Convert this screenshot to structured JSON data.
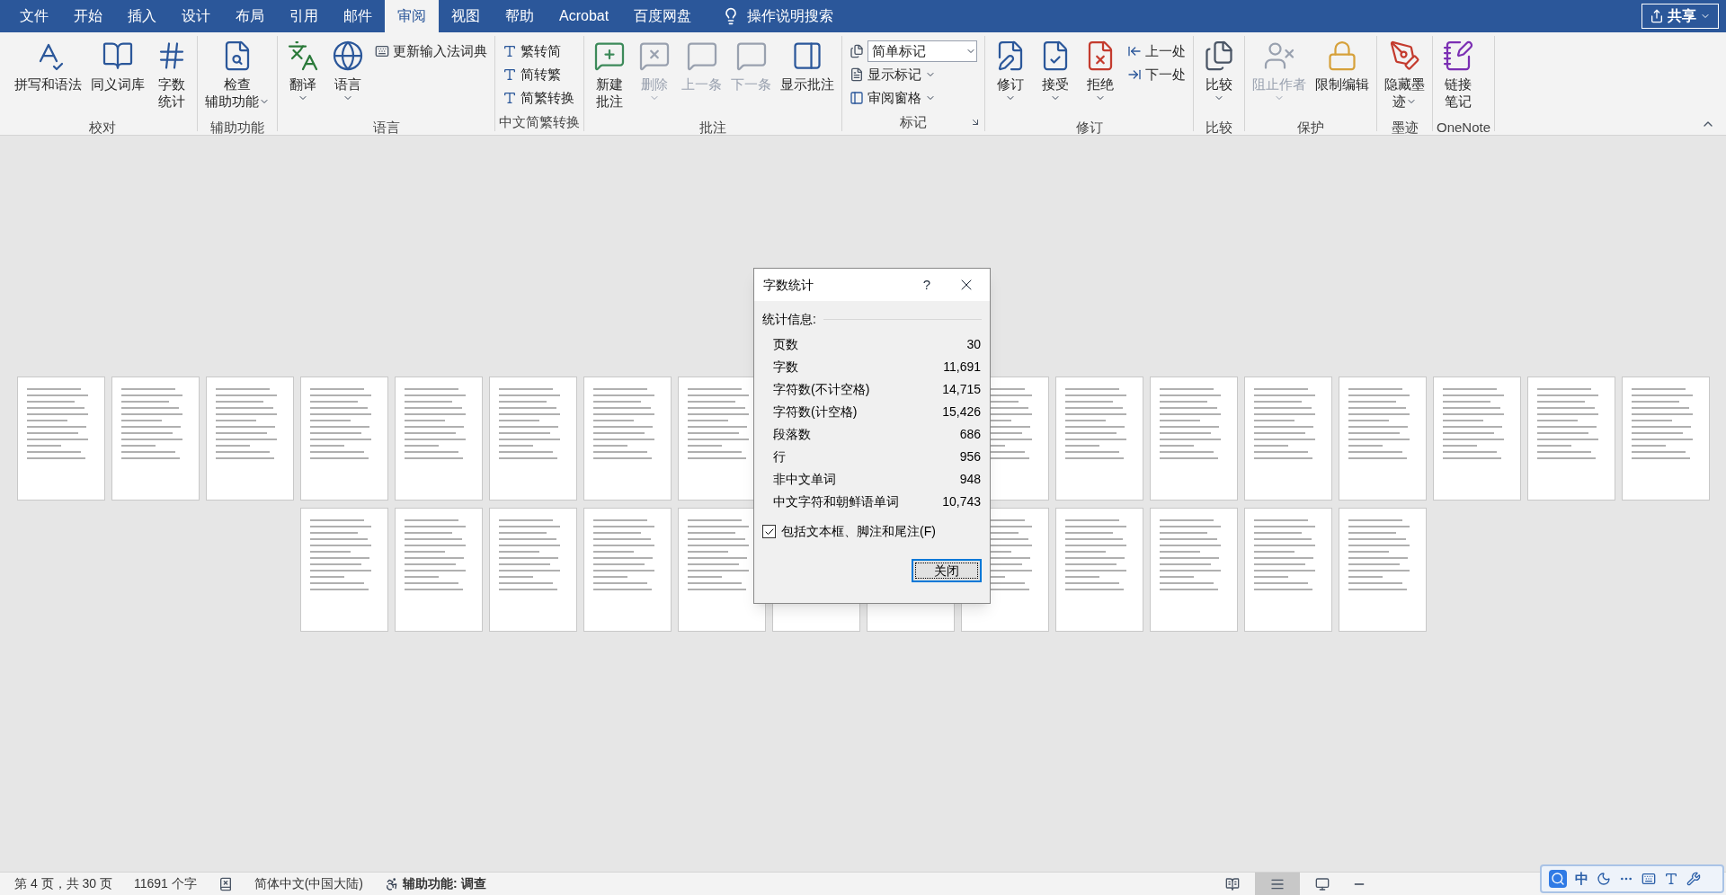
{
  "menu_tabs": [
    {
      "label": "文件",
      "selected": false
    },
    {
      "label": "开始",
      "selected": false
    },
    {
      "label": "插入",
      "selected": false
    },
    {
      "label": "设计",
      "selected": false
    },
    {
      "label": "布局",
      "selected": false
    },
    {
      "label": "引用",
      "selected": false
    },
    {
      "label": "邮件",
      "selected": false
    },
    {
      "label": "审阅",
      "selected": true
    },
    {
      "label": "视图",
      "selected": false
    },
    {
      "label": "帮助",
      "selected": false
    },
    {
      "label": "Acrobat",
      "selected": false
    },
    {
      "label": "百度网盘",
      "selected": false
    }
  ],
  "search": {
    "label": "操作说明搜索"
  },
  "share_button": {
    "label": "共享"
  },
  "ribbon_groups": [
    {
      "label": "校对",
      "launcher": false,
      "items": [
        {
          "kind": "large",
          "lines": [
            "拼写和语法"
          ],
          "disabled": false,
          "dropdown": false
        },
        {
          "kind": "large",
          "lines": [
            "同义词库"
          ],
          "disabled": false,
          "dropdown": false
        },
        {
          "kind": "large",
          "lines": [
            "字数",
            "统计"
          ],
          "disabled": false,
          "dropdown": false
        }
      ]
    },
    {
      "label": "辅助功能",
      "launcher": false,
      "items": [
        {
          "kind": "large",
          "lines": [
            "检查",
            "辅助功能"
          ],
          "disabled": false,
          "dropdown": true
        }
      ]
    },
    {
      "label": "语言",
      "launcher": false,
      "items": [
        {
          "kind": "large",
          "lines": [
            "翻译"
          ],
          "disabled": false,
          "dropdown": true
        },
        {
          "kind": "large",
          "lines": [
            "语言"
          ],
          "disabled": false,
          "dropdown": true
        },
        {
          "kind": "small",
          "lines": [
            "更新输入法词典"
          ],
          "disabled": false,
          "dropdown": false
        }
      ]
    },
    {
      "label": "中文简繁转换",
      "launcher": false,
      "items": [
        {
          "kind": "small",
          "lines": [
            "繁转简"
          ],
          "disabled": false,
          "dropdown": false
        },
        {
          "kind": "small",
          "lines": [
            "简转繁"
          ],
          "disabled": false,
          "dropdown": false
        },
        {
          "kind": "small",
          "lines": [
            "简繁转换"
          ],
          "disabled": false,
          "dropdown": false
        }
      ]
    },
    {
      "label": "批注",
      "launcher": false,
      "items": [
        {
          "kind": "large",
          "lines": [
            "新建",
            "批注"
          ],
          "disabled": false,
          "dropdown": false
        },
        {
          "kind": "large",
          "lines": [
            "删除"
          ],
          "disabled": true,
          "dropdown": true
        },
        {
          "kind": "large",
          "lines": [
            "上一条"
          ],
          "disabled": true,
          "dropdown": false
        },
        {
          "kind": "large",
          "lines": [
            "下一条"
          ],
          "disabled": true,
          "dropdown": false
        },
        {
          "kind": "large",
          "lines": [
            "显示批注"
          ],
          "disabled": false,
          "dropdown": false
        }
      ]
    },
    {
      "label": "标记",
      "launcher": true,
      "items": [
        {
          "kind": "combo",
          "lines": [
            "简单标记"
          ],
          "disabled": false,
          "dropdown": true
        },
        {
          "kind": "small",
          "lines": [
            "显示标记"
          ],
          "disabled": false,
          "dropdown": true
        },
        {
          "kind": "small",
          "lines": [
            "审阅窗格"
          ],
          "disabled": false,
          "dropdown": true
        }
      ]
    },
    {
      "label": "修订",
      "launcher": false,
      "items": [
        {
          "kind": "large",
          "lines": [
            "修订"
          ],
          "disabled": false,
          "dropdown": true
        },
        {
          "kind": "large",
          "lines": [
            "接受"
          ],
          "disabled": false,
          "dropdown": true
        },
        {
          "kind": "large",
          "lines": [
            "拒绝"
          ],
          "disabled": false,
          "dropdown": true
        },
        {
          "kind": "small",
          "lines": [
            "上一处"
          ],
          "disabled": false,
          "dropdown": false
        },
        {
          "kind": "small",
          "lines": [
            "下一处"
          ],
          "disabled": false,
          "dropdown": false
        }
      ]
    },
    {
      "label": "比较",
      "launcher": false,
      "items": [
        {
          "kind": "large",
          "lines": [
            "比较"
          ],
          "disabled": false,
          "dropdown": true
        }
      ]
    },
    {
      "label": "保护",
      "launcher": false,
      "items": [
        {
          "kind": "large",
          "lines": [
            "阻止作者"
          ],
          "disabled": true,
          "dropdown": true
        },
        {
          "kind": "large",
          "lines": [
            "限制编辑"
          ],
          "disabled": false,
          "dropdown": false
        }
      ]
    },
    {
      "label": "墨迹",
      "launcher": false,
      "items": [
        {
          "kind": "large",
          "lines": [
            "隐藏墨",
            "迹"
          ],
          "disabled": false,
          "dropdown": true
        }
      ]
    },
    {
      "label": "OneNote",
      "launcher": false,
      "items": [
        {
          "kind": "large",
          "lines": [
            "链接",
            "笔记"
          ],
          "disabled": false,
          "dropdown": false
        }
      ]
    }
  ],
  "dialog": {
    "title": "字数统计",
    "help": "?",
    "section": "统计信息:",
    "stats": [
      {
        "label": "页数",
        "value": "30"
      },
      {
        "label": "字数",
        "value": "11,691"
      },
      {
        "label": "字符数(不计空格)",
        "value": "14,715"
      },
      {
        "label": "字符数(计空格)",
        "value": "15,426"
      },
      {
        "label": "段落数",
        "value": "686"
      },
      {
        "label": "行",
        "value": "956"
      },
      {
        "label": "非中文单词",
        "value": "948"
      },
      {
        "label": "中文字符和朝鲜语单词",
        "value": "10,743"
      }
    ],
    "checkbox": {
      "label": "包括文本框、脚注和尾注(F)",
      "checked": true
    },
    "close_button": "关闭"
  },
  "status_bar": {
    "page": "第 4 页，共 30 页",
    "words": "11691 个字",
    "language": "简体中文(中国大陆)",
    "accessibility": "辅助功能: 调查",
    "views": [
      {
        "selected": false
      },
      {
        "selected": true
      },
      {
        "selected": false
      }
    ]
  },
  "ime_bar": {
    "mode": "中"
  }
}
